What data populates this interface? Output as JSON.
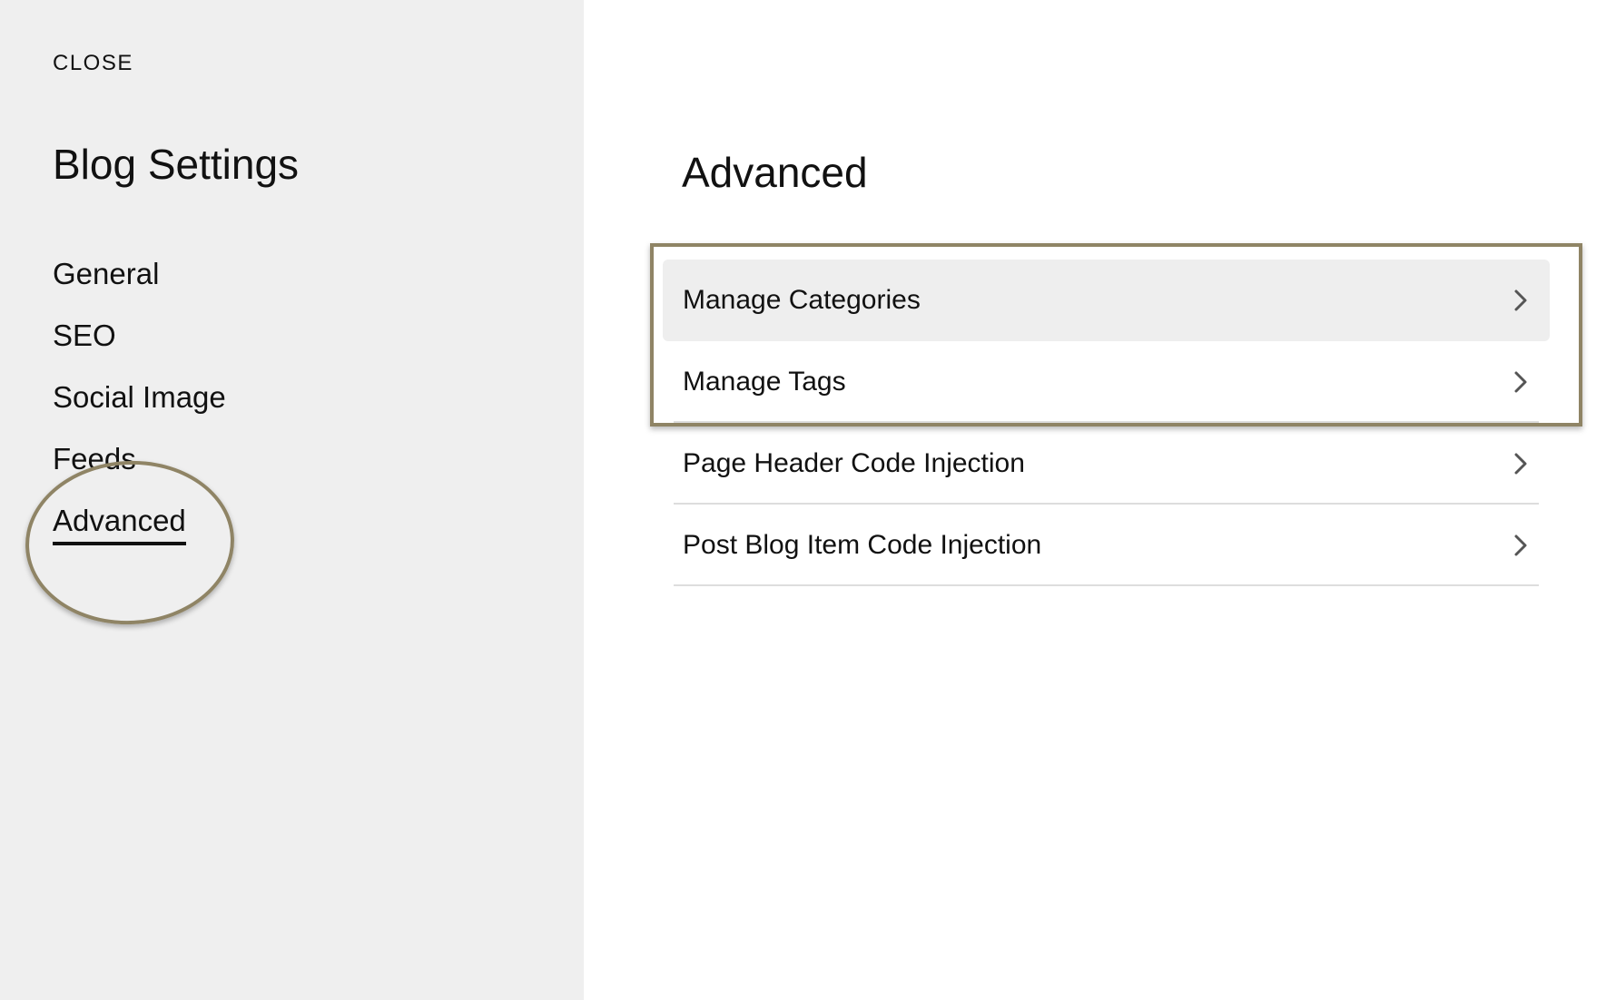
{
  "sidebar": {
    "close_label": "CLOSE",
    "title": "Blog Settings",
    "items": [
      {
        "label": "General",
        "active": false
      },
      {
        "label": "SEO",
        "active": false
      },
      {
        "label": "Social Image",
        "active": false
      },
      {
        "label": "Feeds",
        "active": false
      },
      {
        "label": "Advanced",
        "active": true
      }
    ]
  },
  "main": {
    "title": "Advanced",
    "rows": [
      {
        "label": "Manage Categories",
        "icon": "chevron-right-icon",
        "highlighted": true
      },
      {
        "label": "Manage Tags",
        "icon": "chevron-right-icon",
        "highlighted": false
      },
      {
        "label": "Page Header Code Injection",
        "icon": "chevron-right-icon",
        "highlighted": false
      },
      {
        "label": "Post Blog Item Code Injection",
        "icon": "chevron-right-icon",
        "highlighted": false
      }
    ]
  },
  "colors": {
    "sidebar_background": "#efefef",
    "highlight_row_background": "#eeeeee",
    "annotation_outline": "#8f8465",
    "divider": "#dddddd",
    "text": "#111111"
  }
}
